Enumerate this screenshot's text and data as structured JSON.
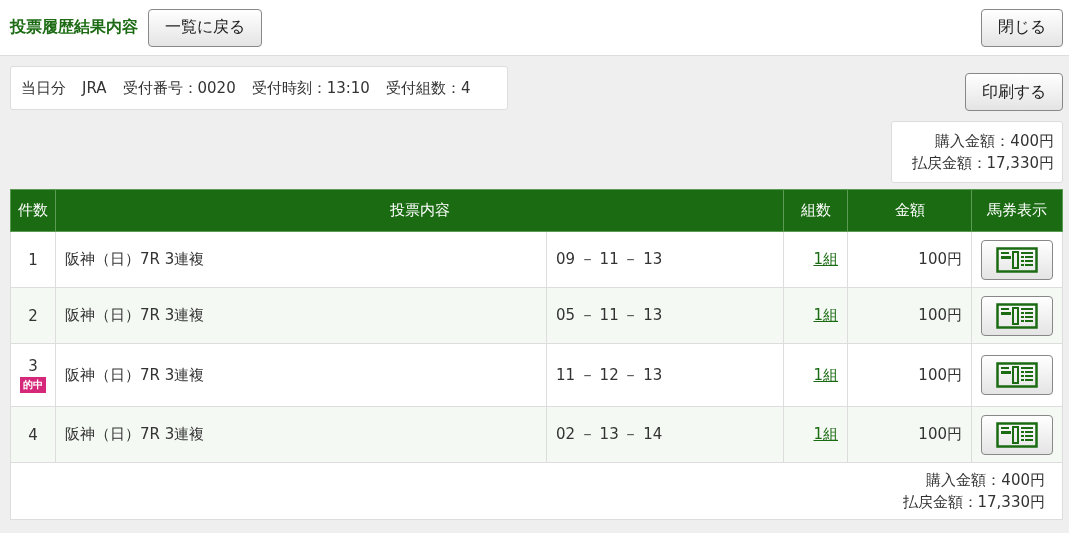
{
  "header": {
    "title": "投票履歴結果内容",
    "back_button": "一覧に戻る",
    "close_button": "閉じる"
  },
  "info": [
    "当日分",
    "JRA",
    "受付番号：0020",
    "受付時刻：13:10",
    "受付組数：4"
  ],
  "print_button": "印刷する",
  "summary_top": [
    "購入金額：400円",
    "払戻金額：17,330円"
  ],
  "table": {
    "columns": [
      "件数",
      "投票内容",
      "組数",
      "金額",
      "馬券表示"
    ],
    "rows": [
      {
        "no": "1",
        "race": "阪神（日）7R  3連複",
        "numbers": "09 － 11 － 13",
        "sets": "1組",
        "amount": "100円"
      },
      {
        "no": "2",
        "race": "阪神（日）7R  3連複",
        "numbers": "05 － 11 － 13",
        "sets": "1組",
        "amount": "100円"
      },
      {
        "no": "3",
        "badge": "的中",
        "race": "阪神（日）7R  3連複",
        "numbers": "11 － 12 － 13",
        "sets": "1組",
        "amount": "100円"
      },
      {
        "no": "4",
        "race": "阪神（日）7R  3連複",
        "numbers": "02 － 13 － 14",
        "sets": "1組",
        "amount": "100円"
      }
    ],
    "footer": [
      "購入金額：400円",
      "払戻金額：17,330円"
    ]
  }
}
